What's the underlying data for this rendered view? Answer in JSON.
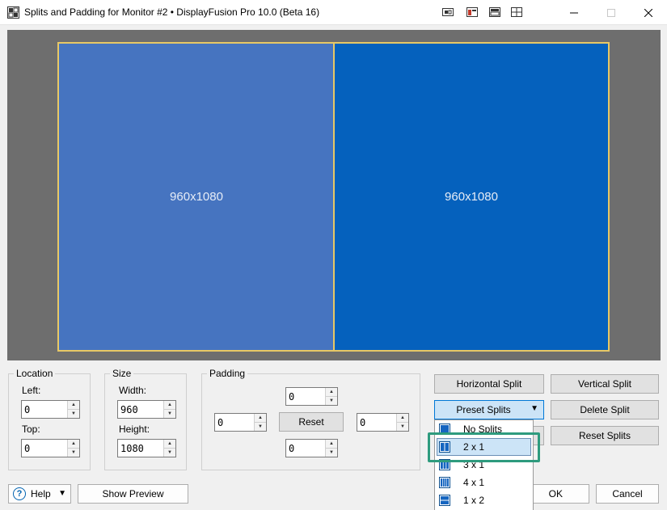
{
  "window": {
    "title": "Splits and Padding for Monitor #2 • DisplayFusion Pro 10.0 (Beta 16)",
    "accent": "#0078d7"
  },
  "preview": {
    "left_split_label": "960x1080",
    "right_split_label": "960x1080",
    "left_color": "#4674c0",
    "right_color": "#0561bd",
    "border_color": "#e8c865"
  },
  "location": {
    "legend": "Location",
    "left_label": "Left:",
    "left_value": "0",
    "top_label": "Top:",
    "top_value": "0"
  },
  "size": {
    "legend": "Size",
    "width_label": "Width:",
    "width_value": "960",
    "height_label": "Height:",
    "height_value": "1080"
  },
  "padding": {
    "legend": "Padding",
    "top_value": "0",
    "left_value": "0",
    "right_value": "0",
    "bottom_value": "0",
    "reset_label": "Reset"
  },
  "actions": {
    "horizontal_split": "Horizontal Split",
    "vertical_split": "Vertical Split",
    "preset_splits": "Preset Splits",
    "delete_split": "Delete Split",
    "reset_splits": "Reset Splits"
  },
  "preset_menu": {
    "items": [
      {
        "label": "No Splits",
        "icon": "no-splits-icon"
      },
      {
        "label": "2 x 1",
        "icon": "two-by-one-icon"
      },
      {
        "label": "3 x 1",
        "icon": "three-by-one-icon"
      },
      {
        "label": "4 x 1",
        "icon": "four-by-one-icon"
      },
      {
        "label": "1 x 2",
        "icon": "one-by-two-icon"
      }
    ],
    "selected": "2 x 1",
    "highlight_color": "#2e9b7e"
  },
  "footer": {
    "help": "Help",
    "show_preview": "Show Preview",
    "ok": "OK",
    "cancel": "Cancel"
  }
}
